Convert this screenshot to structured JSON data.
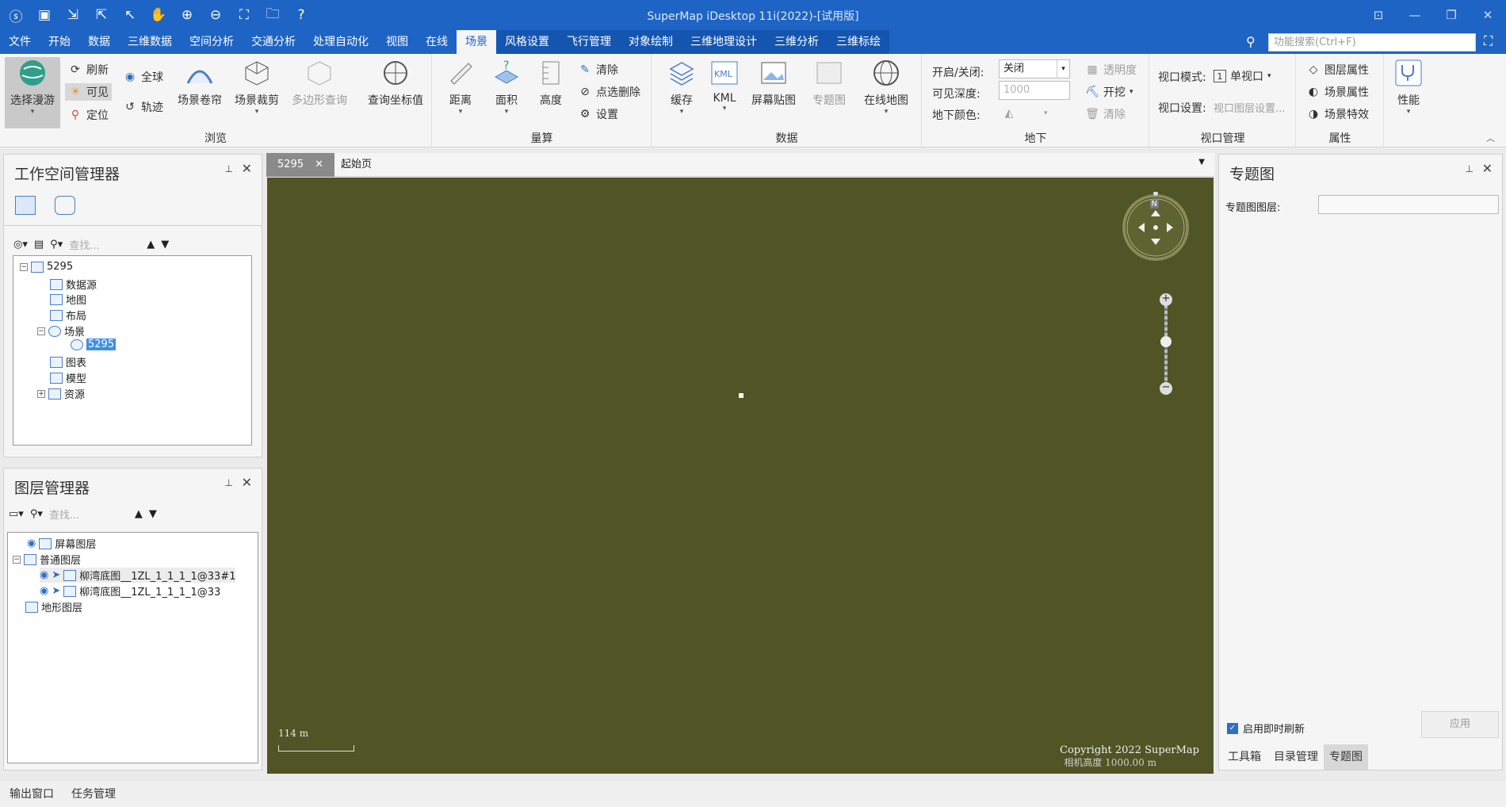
{
  "titlebar": {
    "title": "SuperMap iDesktop 11i(2022)-[试用版]"
  },
  "menu": {
    "tabs": [
      "文件",
      "开始",
      "数据",
      "三维数据",
      "空间分析",
      "交通分析",
      "处理自动化",
      "视图",
      "在线",
      "场景",
      "风格设置",
      "飞行管理",
      "对象绘制",
      "三维地理设计",
      "三维分析",
      "三维标绘"
    ],
    "active": "场景",
    "search_placeholder": "功能搜索(Ctrl+F)"
  },
  "ribbon": {
    "browse": {
      "label": "浏览",
      "select_roam": "选择漫游",
      "refresh": "刷新",
      "visible": "可见",
      "locate": "定位",
      "full_globe": "全球",
      "track": "轨迹",
      "scene_curtain": "场景卷帘",
      "scene_clip": "场景裁剪",
      "polygon_query": "多边形查询",
      "query_coords": "查询坐标值"
    },
    "measure": {
      "label": "量算",
      "distance": "距离",
      "area": "面积",
      "height": "高度",
      "clear": "清除",
      "point_delete": "点选删除",
      "settings": "设置"
    },
    "data": {
      "label": "数据",
      "cache": "缓存",
      "kml": "KML",
      "screen_overlay": "屏幕贴图",
      "thematic_map": "专题图",
      "online_map": "在线地图"
    },
    "underground": {
      "label": "地下",
      "on_off": "开启/关闭:",
      "on_off_value": "关闭",
      "visible_depth": "可见深度:",
      "depth_value": "1000",
      "ground_color": "地下颜色:",
      "transparency": "透明度",
      "excavate": "开挖",
      "clear": "清除"
    },
    "viewport": {
      "label": "视口管理",
      "mode": "视口模式:",
      "mode_value": "单视口",
      "settings": "视口设置:",
      "settings_value": "视口图层设置..."
    },
    "properties": {
      "label": "属性",
      "layer_props": "图层属性",
      "scene_props": "场景属性",
      "scene_effects": "场景特效",
      "performance": "性能"
    }
  },
  "workspace": {
    "title": "工作空间管理器",
    "search_placeholder": "查找...",
    "tree": [
      "5295",
      "数据源",
      "地图",
      "布局",
      "场景",
      "5295",
      "图表",
      "模型",
      "资源"
    ]
  },
  "layers": {
    "title": "图层管理器",
    "search_placeholder": "查找...",
    "tree": [
      "屏幕图层",
      "普通图层",
      "柳湾底图__1ZL_1_1_1_1@33#1",
      "柳湾底图__1ZL_1_1_1_1@33",
      "地形图层"
    ]
  },
  "doc_tabs": [
    "5295",
    "起始页"
  ],
  "map": {
    "scale": "114 m",
    "copyright": "Copyright 2022 SuperMap",
    "camera": "相机高度 1000.00 m",
    "compass_n": "N"
  },
  "thematic": {
    "title": "专题图",
    "layer_label": "专题图图层:",
    "auto_refresh": "启用即时刷新",
    "apply": "应用",
    "bottom_tabs": [
      "工具箱",
      "目录管理",
      "专题图"
    ]
  },
  "status": {
    "output": "输出窗口",
    "tasks": "任务管理"
  },
  "colors": {
    "brand": "#1e64c4",
    "map_bg": "#4f5524"
  }
}
